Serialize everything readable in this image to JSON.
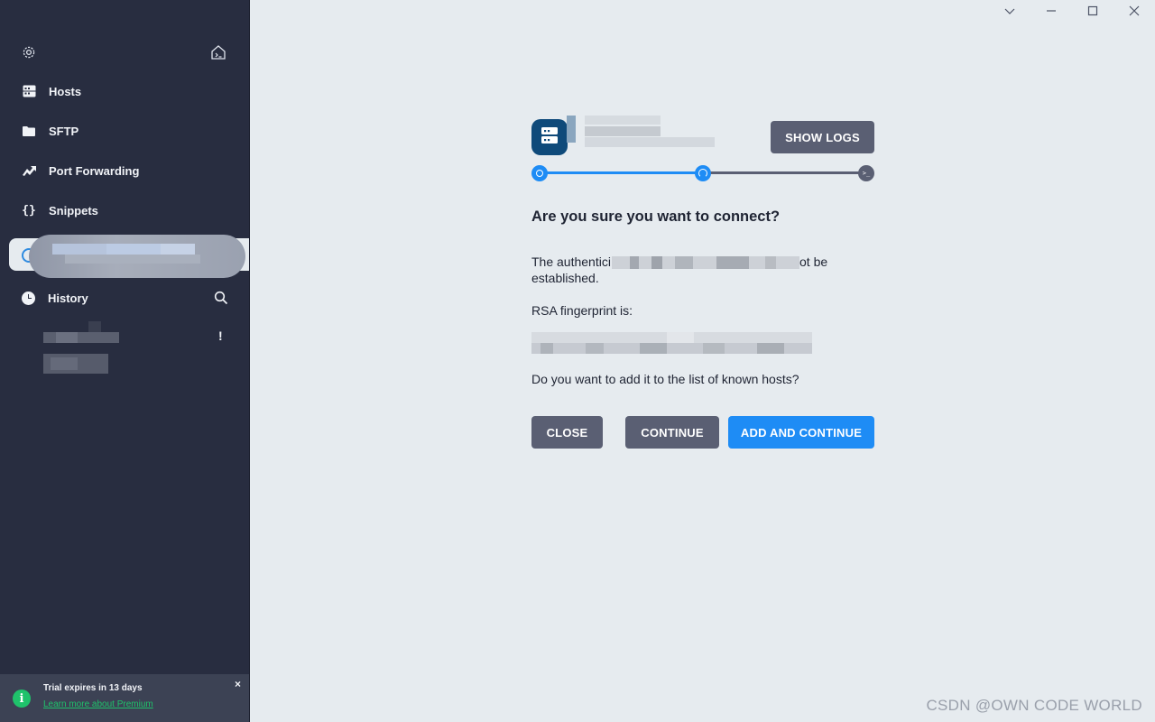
{
  "sidebar": {
    "items": [
      {
        "label": "Hosts",
        "icon": "hosts-icon"
      },
      {
        "label": "SFTP",
        "icon": "folder-icon"
      },
      {
        "label": "Port Forwarding",
        "icon": "port-forwarding-icon"
      },
      {
        "label": "Snippets",
        "icon": "snippets-icon"
      }
    ],
    "history_label": "History",
    "trial": {
      "title": "Trial expires in 13 days",
      "link": "Learn more about Premium"
    }
  },
  "main": {
    "show_logs": "SHOW LOGS",
    "heading": "Are you sure you want to connect?",
    "auth_prefix": "The authentici",
    "auth_suffix": "ot be",
    "auth_line2": "established.",
    "fingerprint_label": "RSA fingerprint is:",
    "question": "Do you want to add it to the list of known hosts?",
    "buttons": {
      "close": "CLOSE",
      "continue": "CONTINUE",
      "add_continue": "ADD AND CONTINUE"
    },
    "progress_fraction": 0.5
  },
  "watermark": "CSDN @OWN CODE WORLD",
  "colors": {
    "sidebar_bg": "#282d40",
    "main_bg": "#e6ebef",
    "accent_blue": "#1e8cf5",
    "dark_button": "#5a5f73"
  }
}
